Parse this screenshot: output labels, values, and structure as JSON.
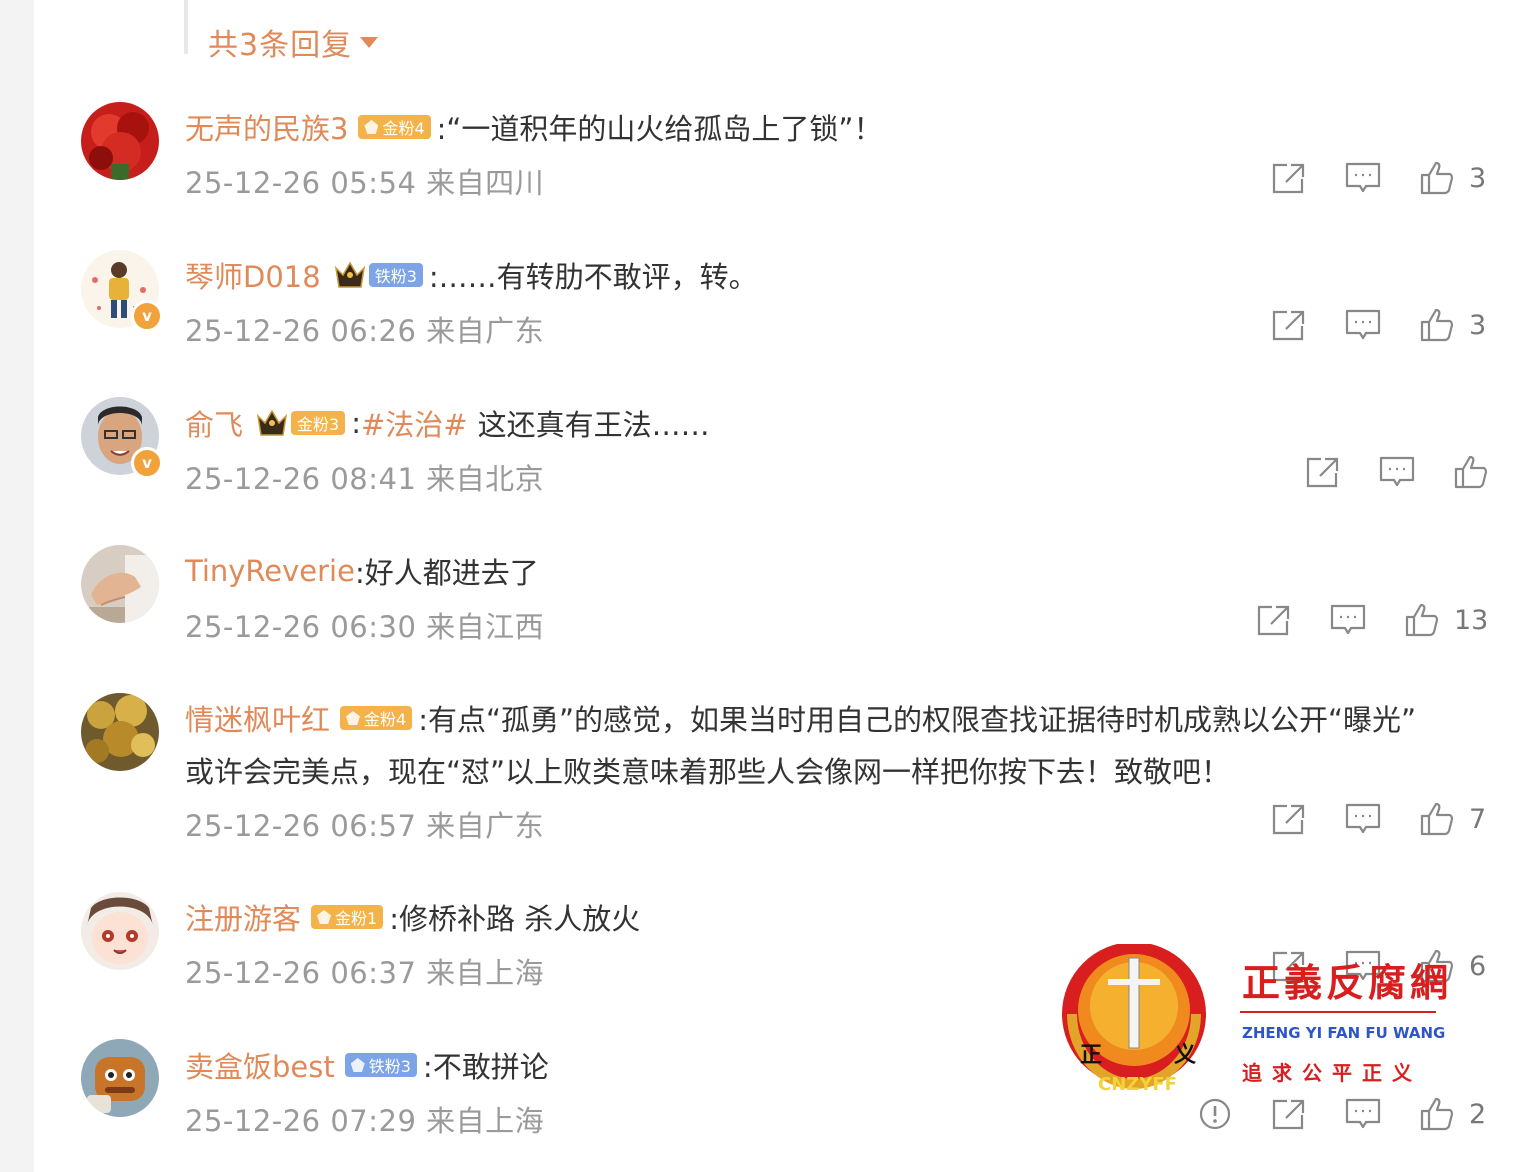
{
  "thread": {
    "reply_count_label": "共3条回复"
  },
  "comments": [
    {
      "username": "无声的民族3",
      "fan_badge": "金粉4",
      "text": ":“一道积年的山火给孤岛上了锁”！",
      "timestamp": "25-12-26 05:54",
      "location": "来自四川",
      "likes": "3",
      "avatar": "red-flower"
    },
    {
      "username": "琴师D018",
      "fan_badge": "铁粉3",
      "text": ":……有转肋不敢评，转。",
      "timestamp": "25-12-26 06:26",
      "location": "来自广东",
      "likes": "3",
      "avatar": "cartoon-person",
      "verified": "v"
    },
    {
      "username": "俞飞",
      "fan_badge": "金粉3",
      "hashtag": "#法治#",
      "text": "这还真有王法……",
      "timestamp": "25-12-26 08:41",
      "location": "来自北京",
      "likes": "",
      "avatar": "man-portrait",
      "verified": "v"
    },
    {
      "username": "TinyReverie",
      "text": ":好人都进去了",
      "timestamp": "25-12-26 06:30",
      "location": "来自江西",
      "likes": "13",
      "avatar": "hand-photo"
    },
    {
      "username": "情迷枫叶红",
      "fan_badge": "金粉4",
      "text_line1": ":有点“孤勇”的感觉，如果当时用自己的权限查找证据待时机成熟以公开“曝光”",
      "text_line2": "或许会完美点，现在“怼”以上败类意味着那些人会像网一样把你按下去！致敬吧！",
      "timestamp": "25-12-26 06:57",
      "location": "来自广东",
      "likes": "7",
      "avatar": "autumn-leaves"
    },
    {
      "username": "注册游客",
      "fan_badge": "金粉1",
      "text": ":修桥补路 杀人放火",
      "timestamp": "25-12-26 06:37",
      "location": "来自上海",
      "likes": "6",
      "avatar": "anime-face"
    },
    {
      "username": "卖盒饭best",
      "fan_badge": "铁粉3",
      "text": ":不敢拼论",
      "timestamp": "25-12-26 07:29",
      "location": "来自上海",
      "likes": "2",
      "avatar": "toy-figure"
    }
  ],
  "watermark": {
    "title": "正義反腐網",
    "pinyin": "ZHENG YI FAN FU WANG",
    "slogan": "追求公平正义",
    "seal_text": "CNZYFF",
    "seal_left_char": "正",
    "seal_right_char": "义"
  },
  "colors": {
    "username": "#e08a5a",
    "meta": "#9a9a9a",
    "gold_badge": "#f3b24a",
    "iron_badge": "#7da4e6",
    "watermark_red": "#d81e1e"
  },
  "icons": [
    "share-icon",
    "comment-icon",
    "like-icon",
    "report-icon",
    "chevron-down-icon",
    "crown-icon"
  ]
}
